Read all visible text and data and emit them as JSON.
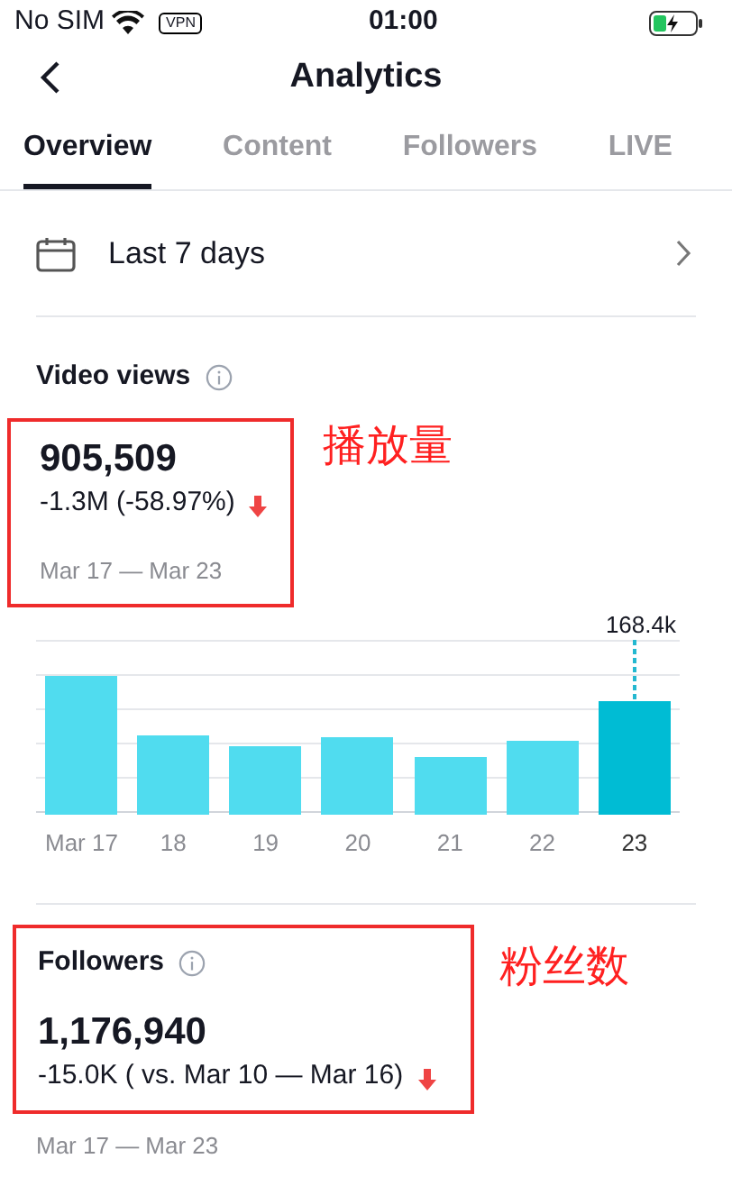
{
  "status_bar": {
    "carrier": "No SIM",
    "vpn": "VPN",
    "time": "01:00"
  },
  "header": {
    "title": "Analytics"
  },
  "tabs": [
    {
      "label": "Overview",
      "selected": true
    },
    {
      "label": "Content",
      "selected": false
    },
    {
      "label": "Followers",
      "selected": false
    },
    {
      "label": "LIVE",
      "selected": false
    }
  ],
  "date_range": {
    "label": "Last 7 days"
  },
  "video_views": {
    "title": "Video views",
    "value": "905,509",
    "change": "-1.3M (-58.97%)",
    "decreased": true,
    "period": "Mar 17 — Mar 23",
    "annotation": "播放量",
    "chart": {
      "peak_label": "168.4k",
      "days": [
        {
          "label": "Mar 17",
          "selected": false
        },
        {
          "label": "18",
          "selected": false
        },
        {
          "label": "19",
          "selected": false
        },
        {
          "label": "20",
          "selected": false
        },
        {
          "label": "21",
          "selected": false
        },
        {
          "label": "22",
          "selected": false
        },
        {
          "label": "23",
          "selected": true
        }
      ]
    }
  },
  "followers": {
    "title": "Followers",
    "value": "1,176,940",
    "change": "-15.0K ( vs. Mar 10 — Mar 16)",
    "decreased": true,
    "period": "Mar 17 — Mar 23",
    "annotation": "粉丝数"
  }
}
